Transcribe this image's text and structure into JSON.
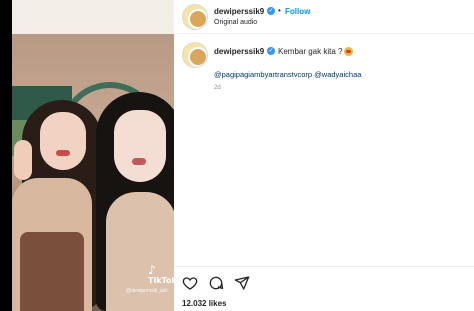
{
  "post": {
    "username": "dewiperssik9",
    "follow_label": "Follow",
    "separator": "•",
    "audio_label": "Original audio",
    "caption_text": "Kembar gak kita ?",
    "mentions": [
      "@pagipagiambyartranstvcorp",
      "@wadyaichaa"
    ],
    "time_ago": "2d",
    "likes": "12.032 likes"
  },
  "media": {
    "watermark_brand": "TikTok",
    "watermark_handle": "@dewiperssik_asli"
  },
  "icons": {
    "verified": "verified-badge-icon",
    "like": "heart-icon",
    "comment": "comment-icon",
    "share": "paper-plane-icon"
  },
  "colors": {
    "accent": "#0095f6",
    "verified": "#3897f0",
    "mention": "#00376b",
    "muted": "#8e8e8e"
  }
}
